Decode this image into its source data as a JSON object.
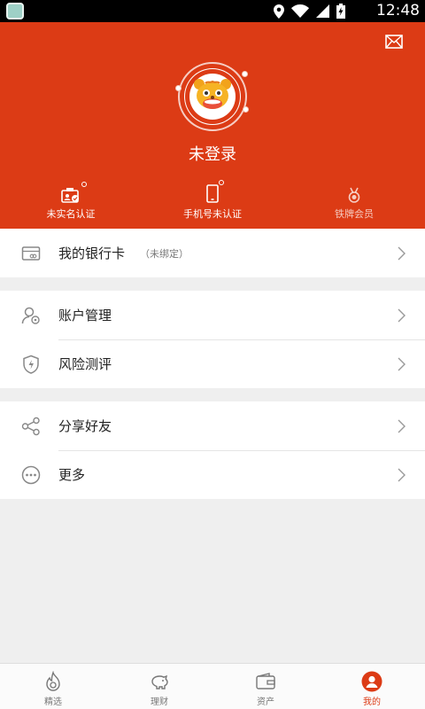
{
  "status_bar": {
    "time": "12:48",
    "icons": [
      "location-icon",
      "wifi-icon",
      "signal-icon",
      "battery-icon"
    ]
  },
  "header": {
    "login_text": "未登录",
    "stats": [
      {
        "label": "未实名认证"
      },
      {
        "label": "手机号未认证"
      },
      {
        "label": "铁牌会员"
      }
    ],
    "colors": {
      "accent": "#dc3b15"
    }
  },
  "menu": {
    "bank_card": {
      "label": "我的银行卡",
      "sub": "（未绑定）"
    },
    "account": {
      "label": "账户管理"
    },
    "risk": {
      "label": "风险测评"
    },
    "share": {
      "label": "分享好友"
    },
    "more": {
      "label": "更多"
    }
  },
  "tabs": [
    {
      "label": "精选",
      "icon": "flame-icon"
    },
    {
      "label": "理财",
      "icon": "piggy-bank-icon"
    },
    {
      "label": "资产",
      "icon": "wallet-icon"
    },
    {
      "label": "我的",
      "icon": "user-icon"
    }
  ],
  "active_tab": "我的"
}
